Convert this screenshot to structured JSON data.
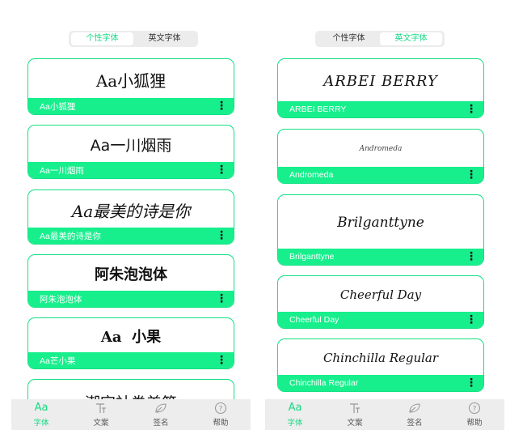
{
  "left": {
    "segment": {
      "tab1": "个性字体",
      "tab2": "英文字体"
    },
    "cards": [
      {
        "preview": "Aa小狐狸",
        "name": "Aa小狐狸"
      },
      {
        "preview": "Aa一川烟雨",
        "name": "Aa一川烟雨"
      },
      {
        "preview": "Aa最美的诗是你",
        "name": "Aa最美的诗是你"
      },
      {
        "preview": "阿朱泡泡体",
        "name": "阿朱泡泡体"
      },
      {
        "preview": "Aa  小果",
        "name": "Aa芒小果"
      },
      {
        "preview": "潮字社卷美简"
      }
    ]
  },
  "right": {
    "segment": {
      "tab1": "个性字体",
      "tab2": "英文字体"
    },
    "cards": [
      {
        "preview": "ARBEI BERRY",
        "name": "ARBEI BERRY"
      },
      {
        "preview": "Andromeda",
        "name": "Andromeda"
      },
      {
        "preview": "Brilganttyne",
        "name": "Brilganttyne"
      },
      {
        "preview": "Cheerful Day",
        "name": "Cheerful Day"
      },
      {
        "preview": "Chinchilla Regular",
        "name": "Chinchilla Regular"
      }
    ]
  },
  "tabbar": {
    "fonts": {
      "icon": "Aa",
      "label": "字体"
    },
    "text": {
      "icon": "text-icon",
      "label": "文案"
    },
    "sign": {
      "icon": "leaf-icon",
      "label": "签名"
    },
    "help": {
      "icon": "help-icon",
      "label": "帮助"
    }
  },
  "colors": {
    "accent": "#17ef8c",
    "accent_text": "#17d985",
    "tabbar_bg": "#ededed"
  }
}
